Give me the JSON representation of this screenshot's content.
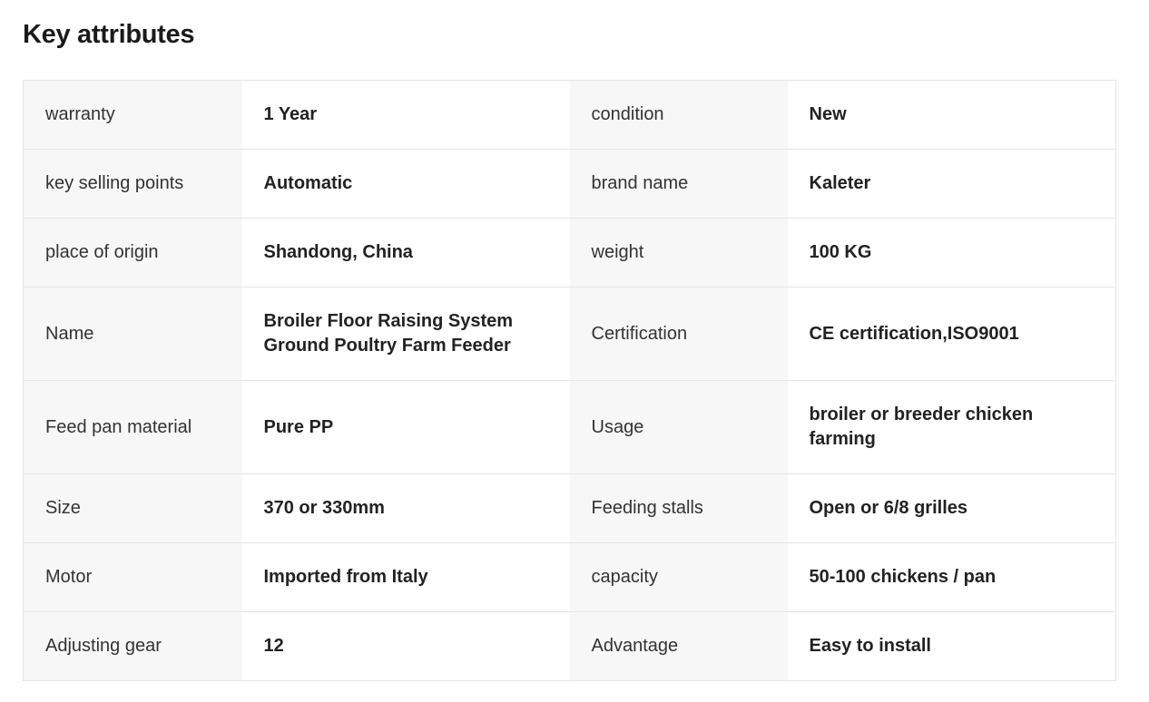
{
  "section": {
    "title": "Key attributes"
  },
  "rows": [
    {
      "k1": "warranty",
      "v1": "1 Year",
      "k2": "condition",
      "v2": "New"
    },
    {
      "k1": "key selling points",
      "v1": "Automatic",
      "k2": "brand name",
      "v2": "Kaleter"
    },
    {
      "k1": "place of origin",
      "v1": "Shandong, China",
      "k2": "weight",
      "v2": "100 KG"
    },
    {
      "k1": "Name",
      "v1": "Broiler Floor Raising System Ground Poultry Farm Feeder",
      "k2": "Certification",
      "v2": "CE certification,ISO9001"
    },
    {
      "k1": "Feed pan material",
      "v1": "Pure PP",
      "k2": "Usage",
      "v2": "broiler or breeder chicken farming"
    },
    {
      "k1": "Size",
      "v1": "370 or 330mm",
      "k2": "Feeding stalls",
      "v2": "Open or 6/8 grilles"
    },
    {
      "k1": "Motor",
      "v1": "Imported from Italy",
      "k2": "capacity",
      "v2": "50-100 chickens / pan"
    },
    {
      "k1": "Adjusting gear",
      "v1": "12",
      "k2": "Advantage",
      "v2": "Easy to install"
    }
  ]
}
